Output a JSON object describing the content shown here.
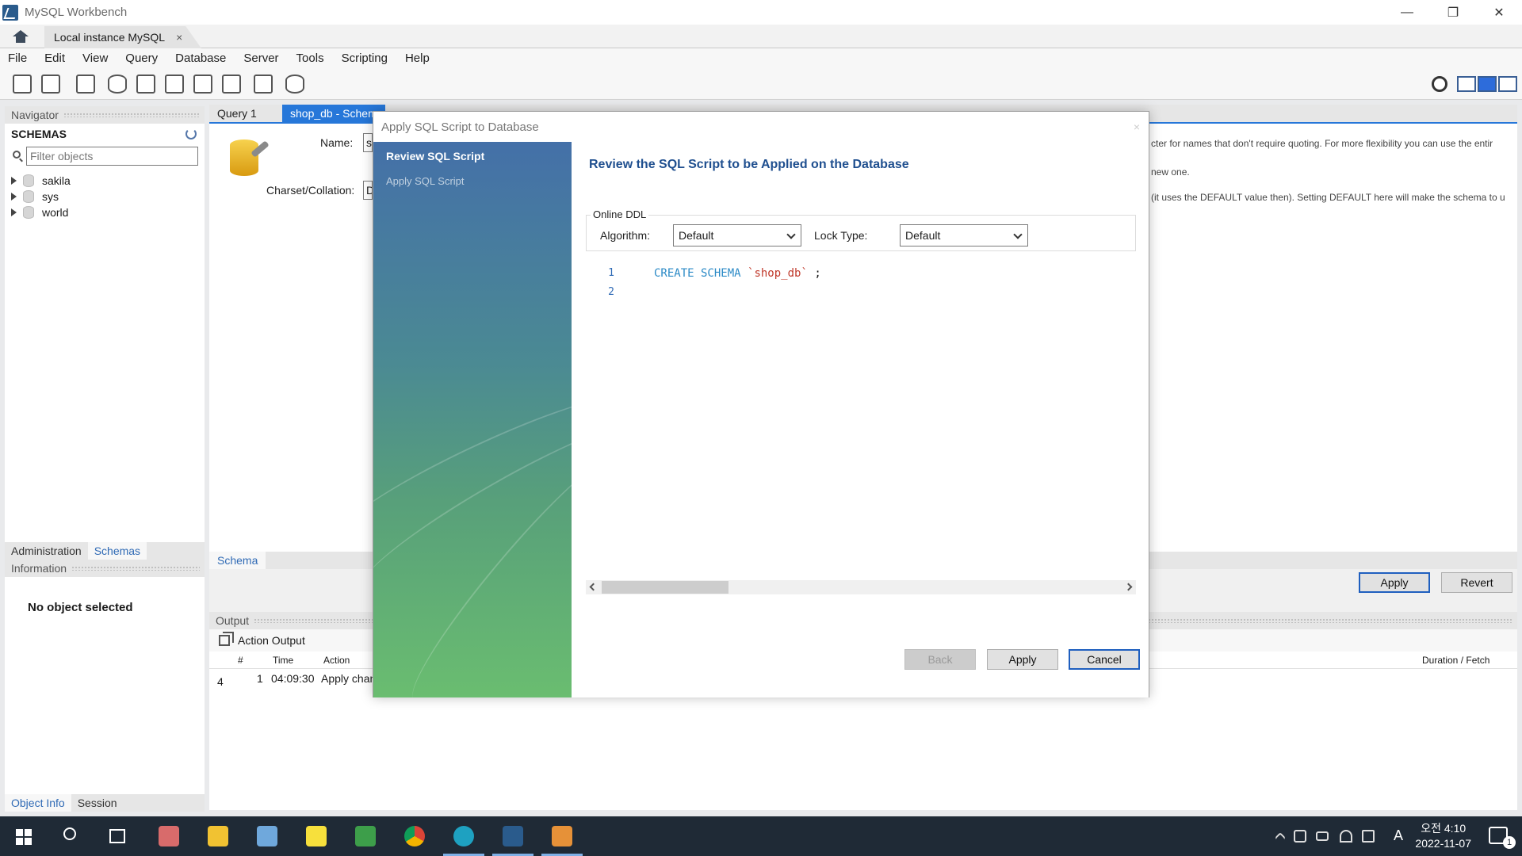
{
  "window": {
    "title": "MySQL Workbench",
    "minimize": "—",
    "restore": "❐",
    "close": "✕"
  },
  "tabs": {
    "connection": "Local instance MySQL",
    "close": "×"
  },
  "menu": [
    "File",
    "Edit",
    "View",
    "Query",
    "Database",
    "Server",
    "Tools",
    "Scripting",
    "Help"
  ],
  "navigator": {
    "header": "Navigator",
    "schemas_title": "SCHEMAS",
    "filter_placeholder": "Filter objects",
    "schemas": [
      "sakila",
      "sys",
      "world"
    ],
    "tabs": [
      "Administration",
      "Schemas"
    ],
    "info_header": "Information",
    "info_text": "No object selected",
    "bottom_tabs": [
      "Object Info",
      "Session"
    ]
  },
  "editor": {
    "tabs": [
      "Query 1",
      "shop_db - Schem"
    ],
    "name_label": "Name:",
    "name_value": "sh",
    "charset_label": "Charset/Collation:",
    "charset_value": "D",
    "help1": "cter for names that don't require quoting. For more flexibility you can use the entir",
    "help2": "new one.",
    "help3": "(it uses the DEFAULT value then). Setting DEFAULT here will make the schema to u",
    "schema_tab": "Schema",
    "apply_btn": "Apply",
    "revert_btn": "Revert"
  },
  "output": {
    "header": "Output",
    "action_output": "Action Output",
    "columns": [
      "#",
      "Time",
      "Action",
      "Duration / Fetch"
    ],
    "row": {
      "status": "4",
      "num": "1",
      "time": "04:09:30",
      "action": "Apply chan"
    }
  },
  "dialog": {
    "title": "Apply SQL Script to Database",
    "close": "×",
    "steps": [
      "Review SQL Script",
      "Apply SQL Script"
    ],
    "heading": "Review the SQL Script to be Applied on the Database",
    "online_ddl": "Online DDL",
    "algorithm_label": "Algorithm:",
    "algorithm_value": "Default",
    "lock_label": "Lock Type:",
    "lock_value": "Default",
    "line_numbers": [
      "1",
      "2"
    ],
    "sql_keyword": "CREATE SCHEMA",
    "sql_name": "`shop_db`",
    "sql_end": ";",
    "back_btn": "Back",
    "apply_btn": "Apply",
    "cancel_btn": "Cancel"
  },
  "taskbar": {
    "time": "오전 4:10",
    "date": "2022-11-07",
    "ime": "A",
    "notif_count": "1"
  }
}
